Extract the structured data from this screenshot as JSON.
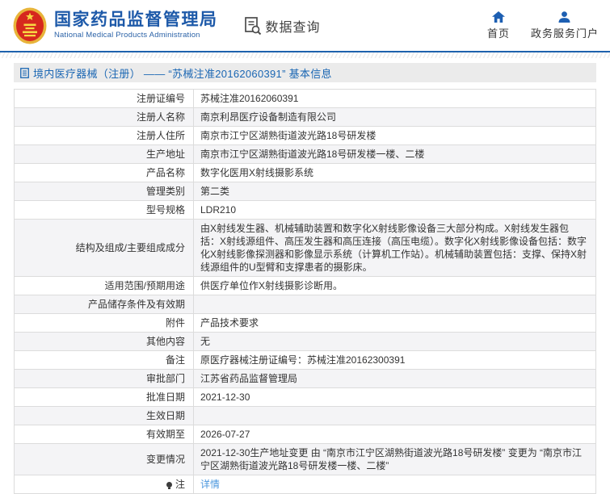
{
  "header": {
    "agency_cn": "国家药品监督管理局",
    "agency_en": "National Medical Products Administration",
    "query_tab": "数据查询",
    "nav": [
      {
        "label": "首页",
        "icon": "home-icon"
      },
      {
        "label": "政务服务门户",
        "icon": "user-icon"
      }
    ]
  },
  "title_bar": {
    "title": "境内医疗器械（注册） —— “苏械注准20162060391” 基本信息"
  },
  "table": {
    "rows": [
      {
        "label": "注册证编号",
        "value": "苏械注准20162060391"
      },
      {
        "label": "注册人名称",
        "value": "南京利昂医疗设备制造有限公司"
      },
      {
        "label": "注册人住所",
        "value": "南京市江宁区湖熟街道波光路18号研发楼"
      },
      {
        "label": "生产地址",
        "value": "南京市江宁区湖熟街道波光路18号研发楼一楼、二楼"
      },
      {
        "label": "产品名称",
        "value": "数字化医用X射线摄影系统"
      },
      {
        "label": "管理类别",
        "value": "第二类"
      },
      {
        "label": "型号规格",
        "value": "LDR210"
      },
      {
        "label": "结构及组成/主要组成成分",
        "value": "由X射线发生器、机械辅助装置和数字化X射线影像设备三大部分构成。X射线发生器包括：X射线源组件、高压发生器和高压连接（高压电缆）。数字化X射线影像设备包括：数字化X射线影像探测器和影像显示系统（计算机工作站）。机械辅助装置包括：支撑、保持X射线源组件的U型臂和支撑患者的摄影床。"
      },
      {
        "label": "适用范围/预期用途",
        "value": "供医疗单位作X射线摄影诊断用。"
      },
      {
        "label": "产品储存条件及有效期",
        "value": ""
      },
      {
        "label": "附件",
        "value": "产品技术要求"
      },
      {
        "label": "其他内容",
        "value": "无"
      },
      {
        "label": "备注",
        "value": "原医疗器械注册证编号：苏械注准20162300391"
      },
      {
        "label": "审批部门",
        "value": "江苏省药品监督管理局"
      },
      {
        "label": "批准日期",
        "value": "2021-12-30"
      },
      {
        "label": "生效日期",
        "value": ""
      },
      {
        "label": "有效期至",
        "value": "2026-07-27"
      },
      {
        "label": "变更情况",
        "value": "2021-12-30生产地址变更 由 “南京市江宁区湖熟街道波光路18号研发楼” 变更为 “南京市江宁区湖熟街道波光路18号研发楼一楼、二楼”"
      },
      {
        "label": "注",
        "value": "详情",
        "link": true,
        "icon": "bulb-icon"
      }
    ]
  },
  "colors": {
    "brand_blue": "#1e5aa9",
    "header_rule_blue": "#1e62ad",
    "title_text_blue": "#1a66b3",
    "link_blue": "#4b97de",
    "titlebar_bg": "#ebebeb",
    "row_alt_bg": "#f4f4f6",
    "table_border": "#dcdcdc",
    "emblem_red": "#d6281e",
    "emblem_gold": "#e8b43a"
  }
}
